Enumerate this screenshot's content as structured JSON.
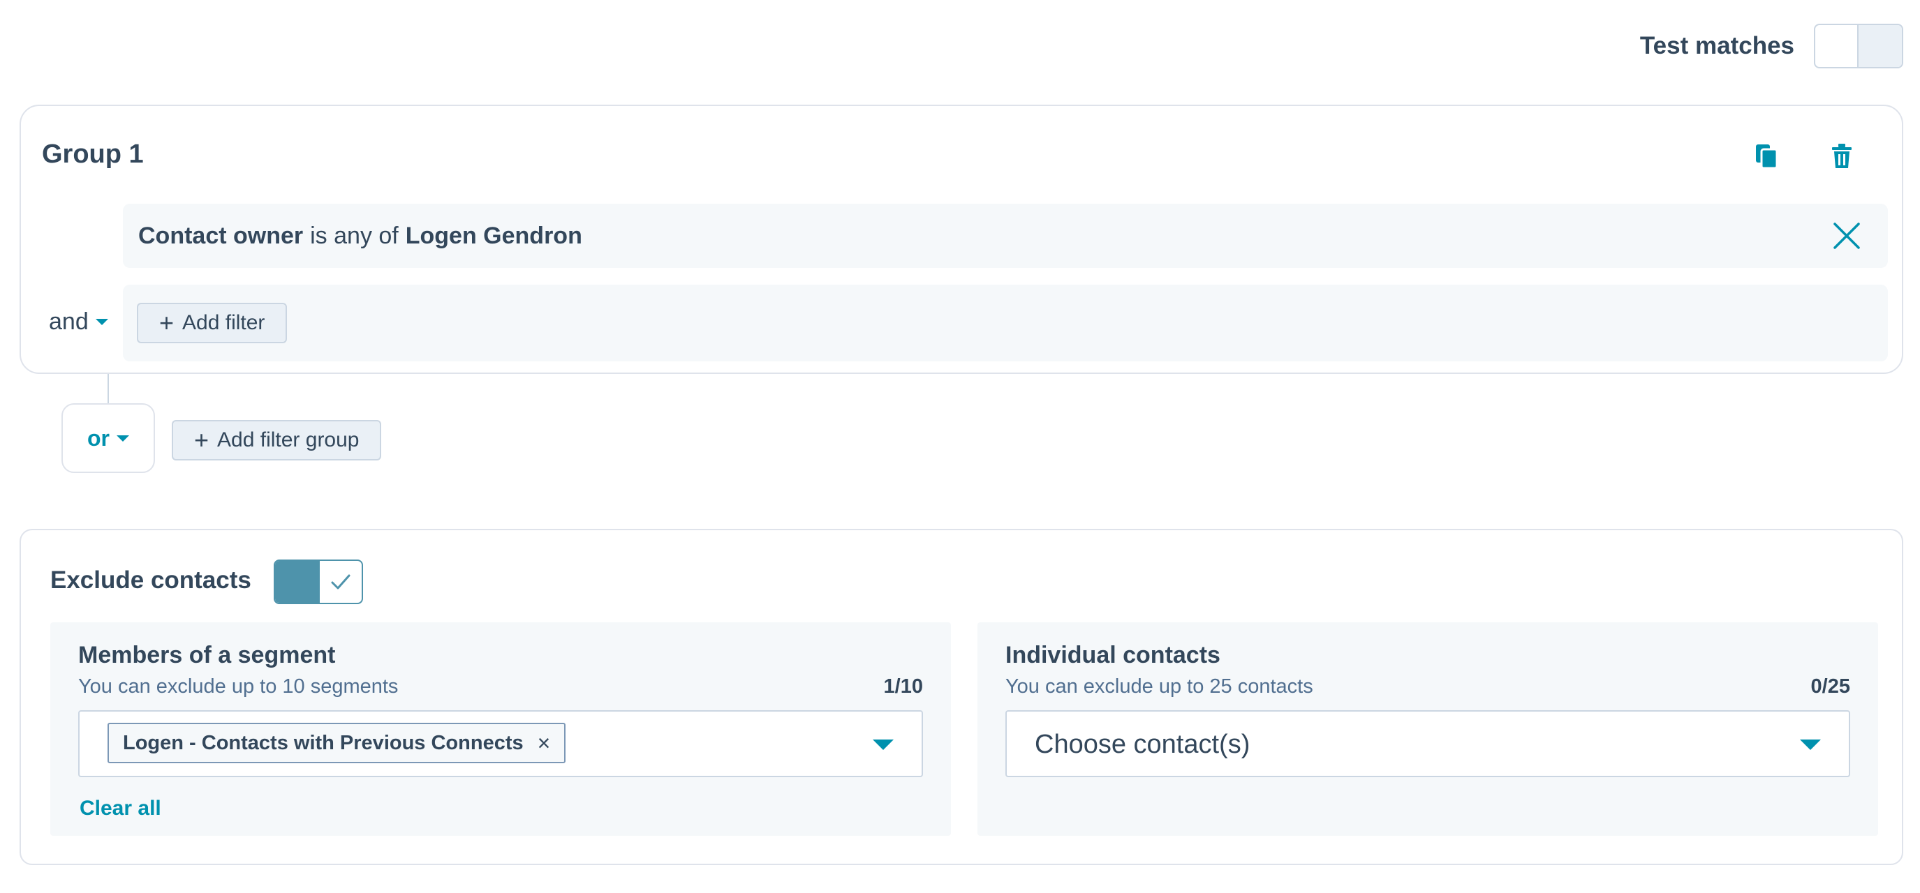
{
  "header": {
    "test_matches_label": "Test matches",
    "test_matches_enabled": false
  },
  "group": {
    "title": "Group 1",
    "actions": [
      "clone-icon",
      "delete-icon"
    ],
    "filter": {
      "property": "Contact owner",
      "operator": "is any of",
      "value": "Logen Gendron"
    },
    "and_label": "and",
    "add_filter_label": "Add filter"
  },
  "or_label": "or",
  "add_filter_group_label": "Add filter group",
  "exclude": {
    "label": "Exclude contacts",
    "enabled": true,
    "segments": {
      "title": "Members of a segment",
      "hint": "You can exclude up to 10 segments",
      "count": "1/10",
      "selected": [
        "Logen - Contacts with Previous Connects"
      ],
      "clear_all_label": "Clear all"
    },
    "individuals": {
      "title": "Individual contacts",
      "hint": "You can exclude up to 25 contacts",
      "count": "0/25",
      "placeholder": "Choose contact(s)"
    }
  },
  "colors": {
    "accent": "#0091ae",
    "toggle_on": "#4e93ab",
    "text": "#33475b",
    "panel_bg": "#f5f8fa",
    "border": "#cbd6e2"
  }
}
